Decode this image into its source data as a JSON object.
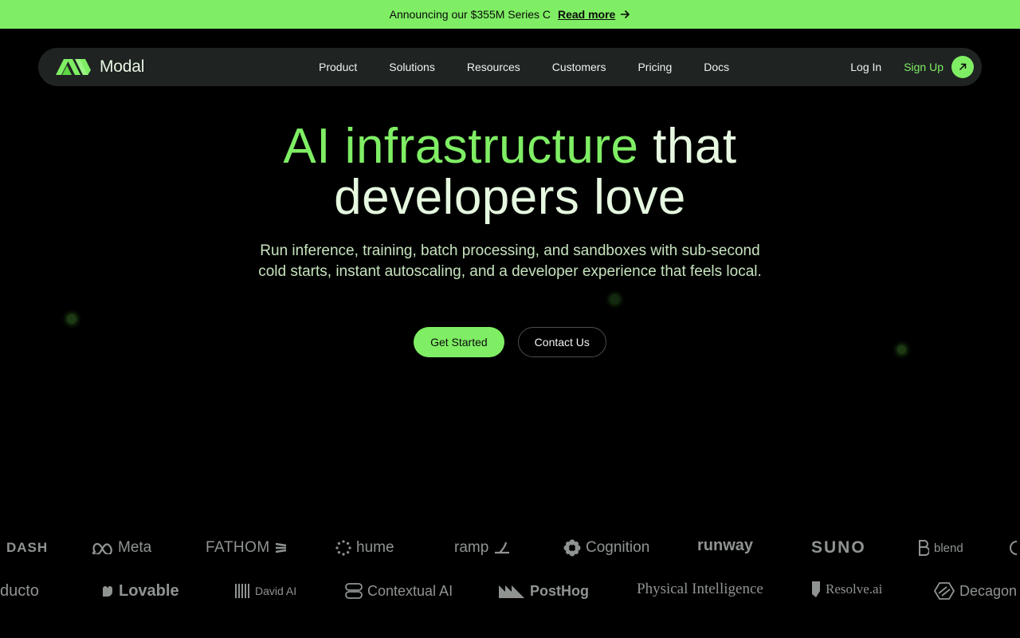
{
  "announcement": {
    "text": "Announcing our $355M Series C",
    "link_label": "Read more"
  },
  "nav": {
    "brand": "Modal",
    "links": [
      "Product",
      "Solutions",
      "Resources",
      "Customers",
      "Pricing",
      "Docs"
    ],
    "login": "Log In",
    "signup": "Sign Up"
  },
  "hero": {
    "title_highlight": "AI infrastructure",
    "title_line1_rest": "that",
    "title_line2": "developers love",
    "subtitle": "Run inference, training, batch processing, and sandboxes with sub-second cold starts, instant autoscaling, and a developer experience that feels local.",
    "primary_cta": "Get Started",
    "secondary_cta": "Contact Us"
  },
  "customers": {
    "row1": [
      "DASH",
      "Meta",
      "FATHOM",
      "hume",
      "ramp",
      "Cognition",
      "runway",
      "SUNO",
      "blend"
    ],
    "row2": [
      "ducto",
      "Lovable",
      "David AI",
      "Contextual AI",
      "PostHog",
      "Physical Intelligence",
      "Resolve.ai",
      "Decagon"
    ]
  },
  "colors": {
    "accent": "#7fee64",
    "background": "#000000",
    "nav_background": "#1f2322",
    "title_light": "#e6f8e0",
    "logo_gray": "#8f9491"
  }
}
